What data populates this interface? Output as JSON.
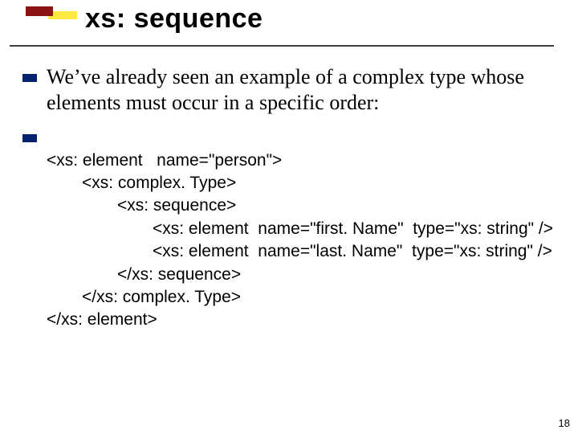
{
  "title": "xs: sequence",
  "intro": "We’ve already seen an example of a complex type whose elements must occur in a specific order:",
  "code": {
    "l1": "<xs: element   name=\"person\">",
    "l2": "<xs: complex. Type>",
    "l3": "<xs: sequence>",
    "l4": "<xs: element  name=\"first. Name\"  type=\"xs: string\" />",
    "l5": "<xs: element  name=\"last. Name\"  type=\"xs: string\" />",
    "l6": "</xs: sequence>",
    "l7": "</xs: complex. Type>",
    "l8": "</xs: element>"
  },
  "page_number": "18"
}
